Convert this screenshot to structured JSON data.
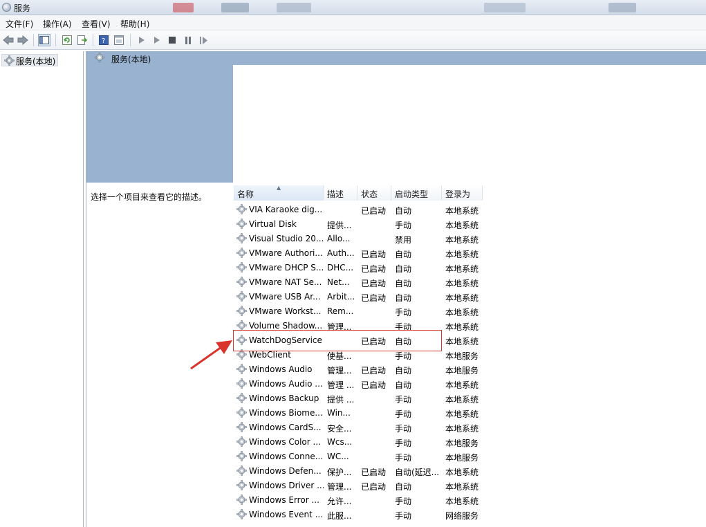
{
  "window": {
    "title": "服务"
  },
  "menu": [
    "文件(F)",
    "操作(A)",
    "查看(V)",
    "帮助(H)"
  ],
  "tree": {
    "item": "服务(本地)"
  },
  "header": {
    "title": "服务(本地)"
  },
  "description_hint": "选择一个项目来查看它的描述。",
  "columns": {
    "name": "名称",
    "description": "描述",
    "status": "状态",
    "startup": "启动类型",
    "logon": "登录为"
  },
  "services": [
    {
      "name": "VIA Karaoke dig...",
      "description": "",
      "status": "已启动",
      "startup": "自动",
      "logon": "本地系统"
    },
    {
      "name": "Virtual Disk",
      "description": "提供...",
      "status": "",
      "startup": "手动",
      "logon": "本地系统"
    },
    {
      "name": "Visual Studio 20...",
      "description": "Allo...",
      "status": "",
      "startup": "禁用",
      "logon": "本地系统"
    },
    {
      "name": "VMware Authori...",
      "description": "Auth...",
      "status": "已启动",
      "startup": "自动",
      "logon": "本地系统"
    },
    {
      "name": "VMware DHCP S...",
      "description": "DHC...",
      "status": "已启动",
      "startup": "自动",
      "logon": "本地系统"
    },
    {
      "name": "VMware NAT Se...",
      "description": "Net...",
      "status": "已启动",
      "startup": "自动",
      "logon": "本地系统"
    },
    {
      "name": "VMware USB Ar...",
      "description": "Arbit...",
      "status": "已启动",
      "startup": "自动",
      "logon": "本地系统"
    },
    {
      "name": "VMware Workst...",
      "description": "Rem...",
      "status": "",
      "startup": "手动",
      "logon": "本地系统"
    },
    {
      "name": "Volume Shadow...",
      "description": "管理...",
      "status": "",
      "startup": "手动",
      "logon": "本地系统"
    },
    {
      "name": "WatchDogService",
      "description": "",
      "status": "已启动",
      "startup": "自动",
      "logon": "本地系统"
    },
    {
      "name": "WebClient",
      "description": "使基...",
      "status": "",
      "startup": "手动",
      "logon": "本地服务"
    },
    {
      "name": "Windows Audio",
      "description": "管理...",
      "status": "已启动",
      "startup": "自动",
      "logon": "本地服务"
    },
    {
      "name": "Windows Audio ...",
      "description": "管理 ...",
      "status": "已启动",
      "startup": "自动",
      "logon": "本地系统"
    },
    {
      "name": "Windows Backup",
      "description": "提供 ...",
      "status": "",
      "startup": "手动",
      "logon": "本地系统"
    },
    {
      "name": "Windows Biome...",
      "description": "Win...",
      "status": "",
      "startup": "手动",
      "logon": "本地系统"
    },
    {
      "name": "Windows CardS...",
      "description": "安全...",
      "status": "",
      "startup": "手动",
      "logon": "本地系统"
    },
    {
      "name": "Windows Color ...",
      "description": "Wcs...",
      "status": "",
      "startup": "手动",
      "logon": "本地服务"
    },
    {
      "name": "Windows Conne...",
      "description": "WC...",
      "status": "",
      "startup": "手动",
      "logon": "本地服务"
    },
    {
      "name": "Windows Defen...",
      "description": "保护...",
      "status": "已启动",
      "startup": "自动(延迟...",
      "logon": "本地系统"
    },
    {
      "name": "Windows Driver ...",
      "description": "管理...",
      "status": "已启动",
      "startup": "自动",
      "logon": "本地系统"
    },
    {
      "name": "Windows Error ...",
      "description": "允许...",
      "status": "",
      "startup": "手动",
      "logon": "本地系统"
    },
    {
      "name": "Windows Event ...",
      "description": "此服...",
      "status": "",
      "startup": "手动",
      "logon": "网络服务"
    }
  ],
  "colors": {
    "header_band": "#98b2cf",
    "highlight": "#d9342b"
  }
}
